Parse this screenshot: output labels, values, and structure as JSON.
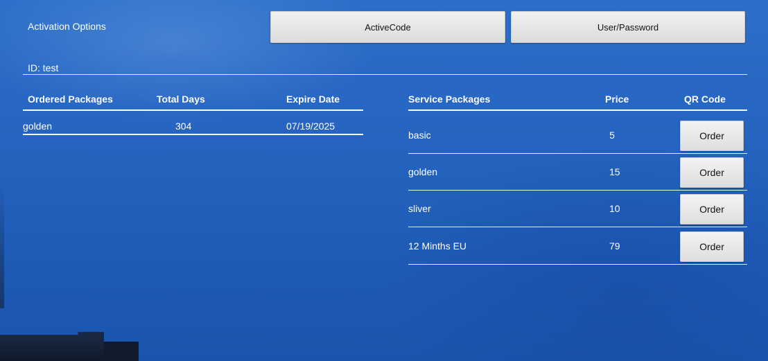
{
  "header": {
    "title": "Activation Options",
    "buttons": {
      "active_code": "ActiveCode",
      "user_password": "User/Password"
    }
  },
  "account": {
    "id_label": "ID: test"
  },
  "ordered": {
    "headers": [
      "Ordered Packages",
      "Total Days",
      "Expire Date"
    ],
    "rows": [
      {
        "package": "golden",
        "total_days": "304",
        "expire_date": "07/19/2025"
      }
    ]
  },
  "service": {
    "headers": [
      "Service Packages",
      "Price",
      "QR Code"
    ],
    "rows": [
      {
        "name": "basic",
        "price": "5",
        "action": "Order"
      },
      {
        "name": "golden",
        "price": "15",
        "action": "Order"
      },
      {
        "name": "sliver",
        "price": "10",
        "action": "Order"
      },
      {
        "name": "12 Minths EU",
        "price": "79",
        "action": "Order"
      }
    ]
  },
  "colors": {
    "background": "#2766c2",
    "text": "#ffffff",
    "button": "#e6e6e6"
  }
}
